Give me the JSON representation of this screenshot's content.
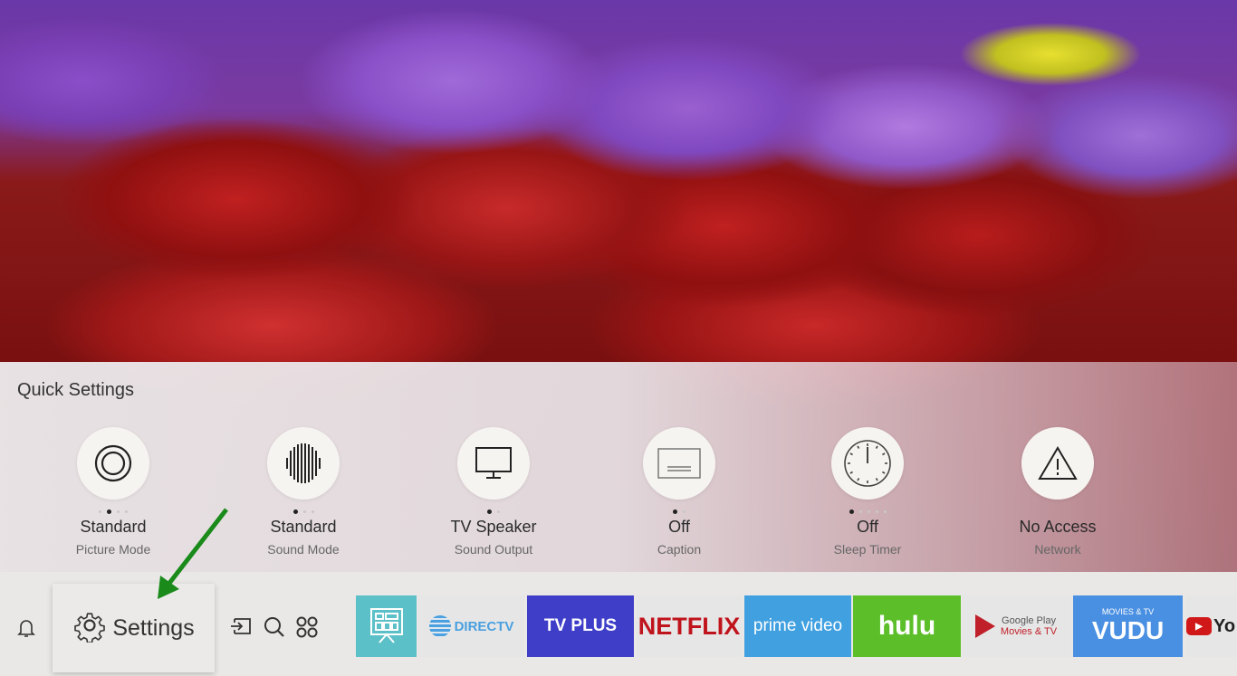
{
  "quick_settings": {
    "title": "Quick Settings",
    "items": [
      {
        "value": "Standard",
        "label": "Picture Mode",
        "icon": "picture-mode-icon",
        "dots": 4,
        "active_dot": 1
      },
      {
        "value": "Standard",
        "label": "Sound Mode",
        "icon": "sound-mode-icon",
        "dots": 3,
        "active_dot": 0
      },
      {
        "value": "TV Speaker",
        "label": "Sound Output",
        "icon": "tv-icon",
        "dots": 2,
        "active_dot": 0
      },
      {
        "value": "Off",
        "label": "Caption",
        "icon": "caption-icon",
        "dots": 2,
        "active_dot": 0
      },
      {
        "value": "Off",
        "label": "Sleep Timer",
        "icon": "clock-icon",
        "dots": 5,
        "active_dot": 0
      },
      {
        "value": "No Access",
        "label": "Network",
        "icon": "warning-icon",
        "dots": 0,
        "active_dot": 0
      }
    ]
  },
  "bar": {
    "settings_label": "Settings",
    "apps": [
      {
        "name": "",
        "bg": "#5cc0c8",
        "fg": "#ffffff"
      },
      {
        "name": "DIRECTV",
        "bg": "#e6e6e6",
        "fg": "#4aa0e0"
      },
      {
        "name": "TV PLUS",
        "bg": "#3e3ec8",
        "fg": "#ffffff"
      },
      {
        "name": "NETFLIX",
        "bg": "#e6e6e6",
        "fg": "#c0141c"
      },
      {
        "name": "prime video",
        "bg": "#40a0e0",
        "fg": "#ffffff"
      },
      {
        "name": "hulu",
        "bg": "#5cbf2a",
        "fg": "#ffffff"
      },
      {
        "name": "Google Play",
        "sub": "Movies & TV",
        "bg": "#e6e6e6",
        "fg": "#555555"
      },
      {
        "name": "VUDU",
        "sub": "MOVIES & TV",
        "bg": "#4a90e2",
        "fg": "#ffffff"
      },
      {
        "name": "Yo",
        "bg": "#e6e6e6",
        "fg": "#222222"
      }
    ]
  },
  "annotation_color": "#1a8a1a"
}
